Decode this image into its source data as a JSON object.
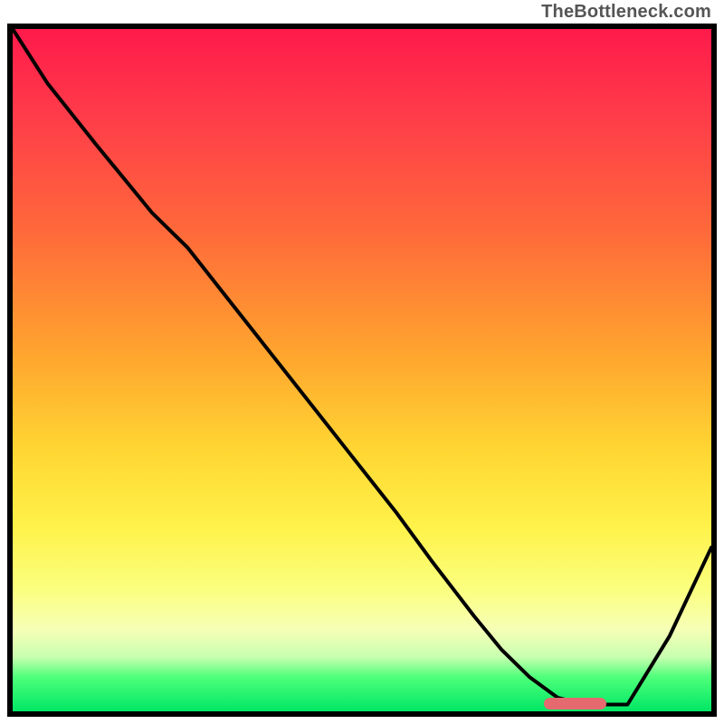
{
  "watermark": "TheBottleneck.com",
  "colors": {
    "border": "#000000",
    "curve_stroke": "#000000",
    "marker": "#e46a6f",
    "gradient_top": "#ff1a4b",
    "gradient_bottom": "#00e765"
  },
  "chart_data": {
    "type": "line",
    "title": "",
    "xlabel": "",
    "ylabel": "",
    "xlim": [
      0,
      100
    ],
    "ylim": [
      0,
      100
    ],
    "grid": false,
    "legend": false,
    "x": [
      0,
      5,
      12,
      20,
      25,
      35,
      45,
      55,
      60,
      66,
      70,
      74,
      78,
      82,
      88,
      94,
      100
    ],
    "values": [
      100,
      92,
      83,
      73,
      68,
      55,
      42,
      29,
      22,
      14,
      9,
      5,
      2,
      1,
      1,
      11,
      24
    ],
    "series": [
      {
        "name": "bottleneck-curve",
        "x": [
          0,
          5,
          12,
          20,
          25,
          35,
          45,
          55,
          60,
          66,
          70,
          74,
          78,
          82,
          88,
          94,
          100
        ],
        "values": [
          100,
          92,
          83,
          73,
          68,
          55,
          42,
          29,
          22,
          14,
          9,
          5,
          2,
          1,
          1,
          11,
          24
        ]
      }
    ],
    "marker": {
      "x_start": 76,
      "x_end": 85,
      "y": 1.2
    }
  }
}
